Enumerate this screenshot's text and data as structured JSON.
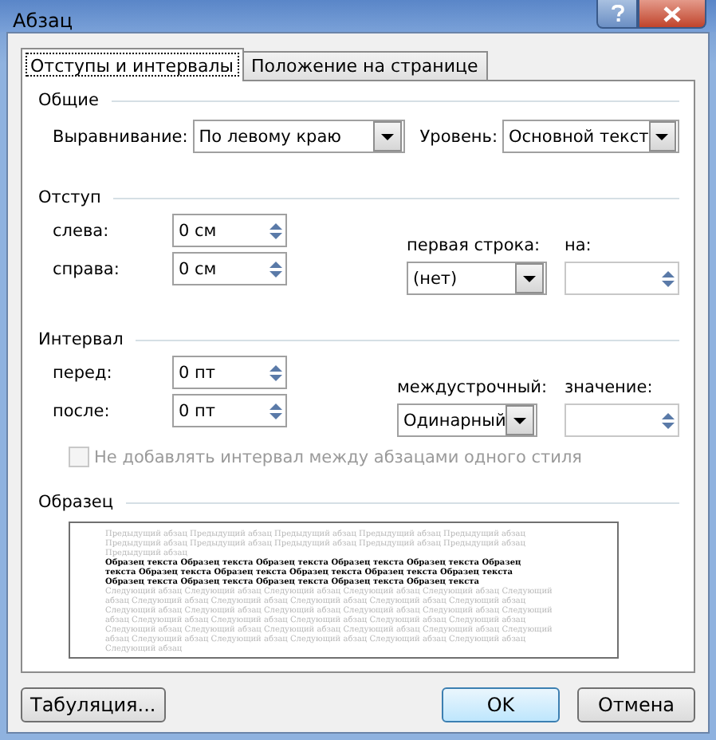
{
  "window": {
    "title": "Абзац"
  },
  "tabs": [
    {
      "label": "Отступы и интервалы",
      "selected": true
    },
    {
      "label": "Положение на странице",
      "selected": false
    }
  ],
  "general": {
    "title": "Общие",
    "alignment": {
      "label": "Выравнивание:",
      "value": "По левому краю"
    },
    "level": {
      "label": "Уровень:",
      "value": "Основной текст"
    }
  },
  "indent": {
    "title": "Отступ",
    "left": {
      "label": "слева:",
      "value": "0 см"
    },
    "right": {
      "label": "справа:",
      "value": "0 см"
    },
    "first_line": {
      "label": "первая строка:",
      "value": "(нет)"
    },
    "by": {
      "label": "на:",
      "disabled": true
    }
  },
  "spacing": {
    "title": "Интервал",
    "before": {
      "label": "перед:",
      "value": "0 пт"
    },
    "after": {
      "label": "после:",
      "value": "0 пт"
    },
    "line_spacing": {
      "label": "междустрочный:",
      "value": "Одинарный"
    },
    "at": {
      "label": "значение:",
      "disabled": true
    },
    "no_space_same_style": {
      "label": "Не добавлять интервал между абзацами одного стиля",
      "checked": false,
      "disabled": true
    }
  },
  "preview": {
    "title": "Образец",
    "previous": "Предыдущий абзац Предыдущий абзац Предыдущий абзац Предыдущий абзац Предыдущий абзац Предыдущий абзац Предыдущий абзац Предыдущий абзац Предыдущий абзац Предыдущий абзац Предыдущий абзац",
    "sample": "Образец текста Образец текста Образец текста Образец текста Образец текста Образец текста Образец текста Образец текста Образец текста Образец текста Образец текста Образец текста Образец текста Образец текста Образец текста Образец текста",
    "next": "Следующий абзац Следующий абзац Следующий абзац Следующий абзац Следующий абзац Следующий абзац Следующий абзац Следующий абзац Следующий абзац Следующий абзац Следующий абзац Следующий абзац Следующий абзац Следующий абзац Следующий абзац Следующий абзац Следующий абзац Следующий абзац Следующий абзац Следующий абзац Следующий абзац Следующий абзац Следующий абзац Следующий абзац Следующий абзац Следующий абзац Следующий абзац Следующий абзац Следующий абзац Следующий абзац Следующий абзац Следующий абзац Следующий абзац Следующий абзац"
  },
  "buttons": {
    "tabs": "Табуляция...",
    "ok": "OK",
    "cancel": "Отмена"
  }
}
